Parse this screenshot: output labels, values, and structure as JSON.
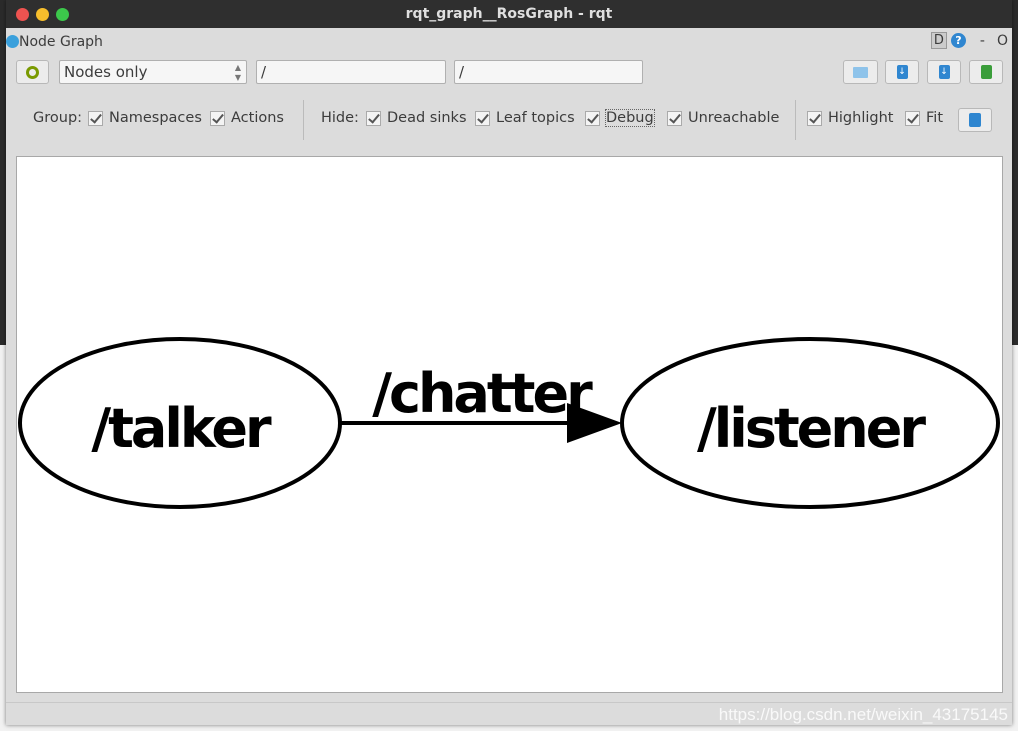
{
  "window": {
    "title": "rqt_graph__RosGraph - rqt",
    "controls": [
      "close",
      "minimize",
      "maximize"
    ]
  },
  "plugin": {
    "title": "Node Graph",
    "icon": "rqt-gear-icon",
    "d_label": "D",
    "help_label": "?",
    "minimize_label": "-",
    "close_label": "O"
  },
  "toolbar": {
    "refresh_icon": "refresh-icon",
    "mode_select": "Nodes only",
    "ns_filter": "/",
    "topic_filter": "/",
    "buttons": [
      "folder-open-icon",
      "save-dot-icon",
      "save-image-icon",
      "export-icon"
    ]
  },
  "options": {
    "group_label": "Group:",
    "group": [
      {
        "label": "Namespaces",
        "checked": true
      },
      {
        "label": "Actions",
        "checked": true
      }
    ],
    "hide_label": "Hide:",
    "hide": [
      {
        "label": "Dead sinks",
        "checked": true
      },
      {
        "label": "Leaf topics",
        "checked": true
      },
      {
        "label": "Debug",
        "checked": true
      },
      {
        "label": "Unreachable",
        "checked": true
      }
    ],
    "view": [
      {
        "label": "Highlight",
        "checked": true
      },
      {
        "label": "Fit",
        "checked": true
      }
    ],
    "fit_button_icon": "fit-view-icon"
  },
  "graph": {
    "nodes": [
      {
        "label": "/talker"
      },
      {
        "label": "/listener"
      }
    ],
    "edges": [
      {
        "from": "/talker",
        "to": "/listener",
        "label": "/chatter"
      }
    ]
  },
  "watermark": "https://blog.csdn.net/weixin_43175145",
  "colors": {
    "accent": "#2f86d0",
    "refresh": "#7a9a01",
    "export": "#3a9d3a"
  }
}
